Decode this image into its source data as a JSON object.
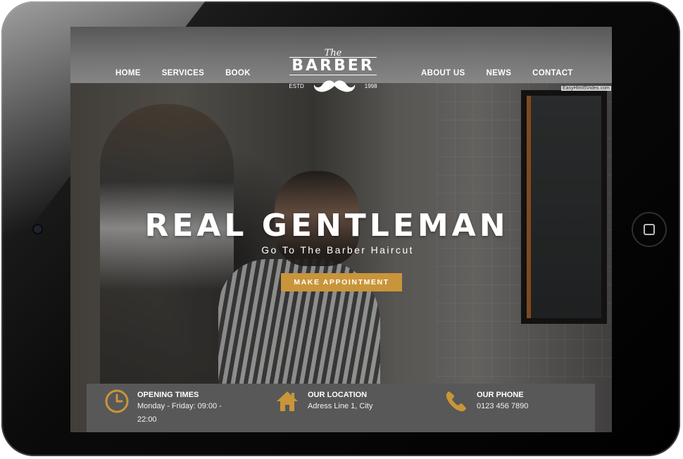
{
  "device": {
    "home_button_icon": "home-button-icon",
    "camera_icon": "camera-icon"
  },
  "nav": {
    "left": [
      "HOME",
      "SERVICES",
      "BOOK"
    ],
    "right": [
      "ABOUT US",
      "NEWS",
      "CONTACT"
    ]
  },
  "logo": {
    "the": "The",
    "word": "BARBER",
    "estd": "ESTD",
    "year": "1998"
  },
  "watermark": "EasyHtml5Video.com",
  "hero": {
    "title": "REAL GENTLEMAN",
    "subtitle": "Go To The Barber Haircut",
    "cta": "MAKE APPOINTMENT"
  },
  "info": {
    "hours": {
      "icon": "clock-icon",
      "title": "OPENING TIMES",
      "text": "Monday - Friday: 09:00 - 22:00"
    },
    "location": {
      "icon": "home-icon",
      "title": "OUR LOCATION",
      "text": "Adress Line 1, City"
    },
    "phone": {
      "icon": "phone-icon",
      "title": "OUR PHONE",
      "text": "0123 456 7890"
    }
  },
  "colors": {
    "accent": "#c9953a",
    "strip": "#585858"
  }
}
